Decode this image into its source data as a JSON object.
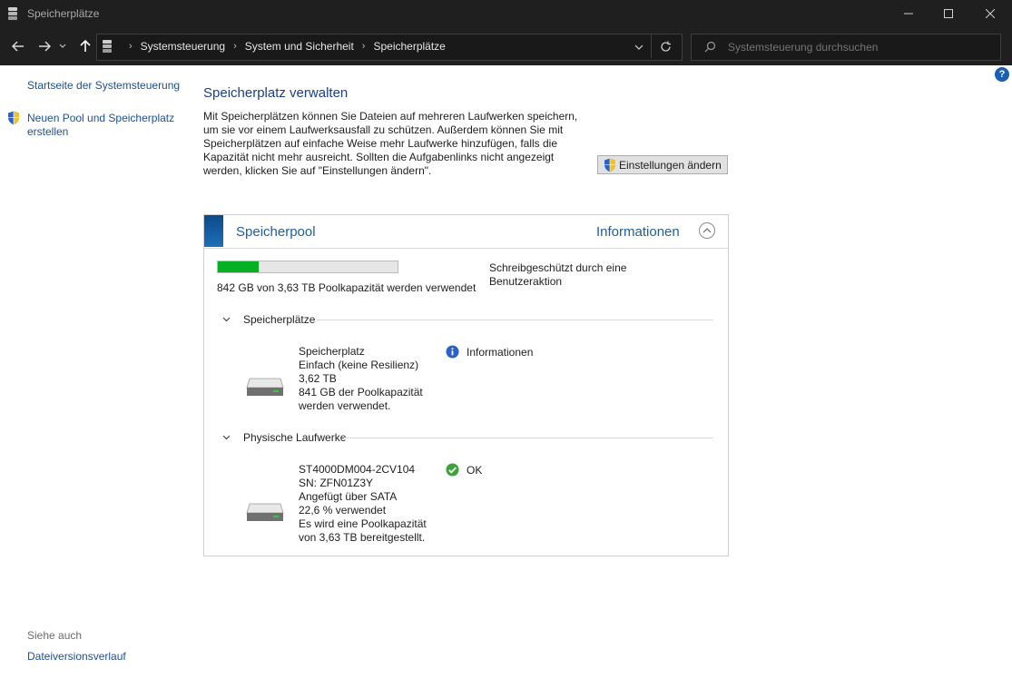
{
  "window": {
    "title": "Speicherplätze",
    "controls": {
      "minimize": "—",
      "maximize": "☐",
      "close": "✕"
    }
  },
  "nav": {
    "back": "←",
    "forward": "→",
    "recent": "⌄",
    "up": "↑",
    "dropdown": "⌄",
    "refresh": "↻"
  },
  "breadcrumb": [
    "Systemsteuerung",
    "System und Sicherheit",
    "Speicherplätze"
  ],
  "breadcrumb_sep": "›",
  "search": {
    "placeholder": "Systemsteuerung durchsuchen"
  },
  "help": "?",
  "left": {
    "home": "Startseite der Systemsteuerung",
    "new_pool": "Neuen Pool und Speicherplatz erstellen",
    "see_also": "Siehe auch",
    "file_history": "Dateiversionsverlauf"
  },
  "main": {
    "heading": "Speicherplatz verwalten",
    "description": "Mit Speicherplätzen können Sie Dateien auf mehreren Laufwerken speichern, um sie vor einem Laufwerksausfall zu schützen. Außerdem können Sie mit Speicherplätzen auf einfache Weise mehr Laufwerke hinzufügen, falls die Kapazität nicht mehr ausreicht. Sollten die Aufgabenlinks nicht angezeigt werden, klicken Sie auf \"Einstellungen ändern\".",
    "settings_button": "Einstellungen ändern"
  },
  "pool": {
    "title": "Speicherpool",
    "info_link": "Informationen",
    "usage_fraction": 0.226,
    "usage_text": "842 GB von 3,63 TB Poolkapazität werden verwendet",
    "write_protect": "Schreibgeschützt durch eine Benutzeraktion",
    "spaces": {
      "header": "Speicherplätze",
      "lines": [
        "Speicherplatz",
        "Einfach (keine Resilienz)",
        "3,62 TB",
        "841 GB der Poolkapazität",
        "werden verwendet."
      ],
      "status": "Informationen"
    },
    "drives": {
      "header": "Physische Laufwerke",
      "lines": [
        "ST4000DM004-2CV104",
        "SN: ZFN01Z3Y",
        "Angefügt über SATA",
        "22,6 % verwendet",
        "Es wird eine Poolkapazität",
        "von 3,63 TB bereitgestellt."
      ],
      "status": "OK"
    }
  },
  "colors": {
    "titlebar": "#1f1f1f",
    "link": "#1c4f9c",
    "heading": "#1c3f8c",
    "bar_fill": "#06b025"
  }
}
